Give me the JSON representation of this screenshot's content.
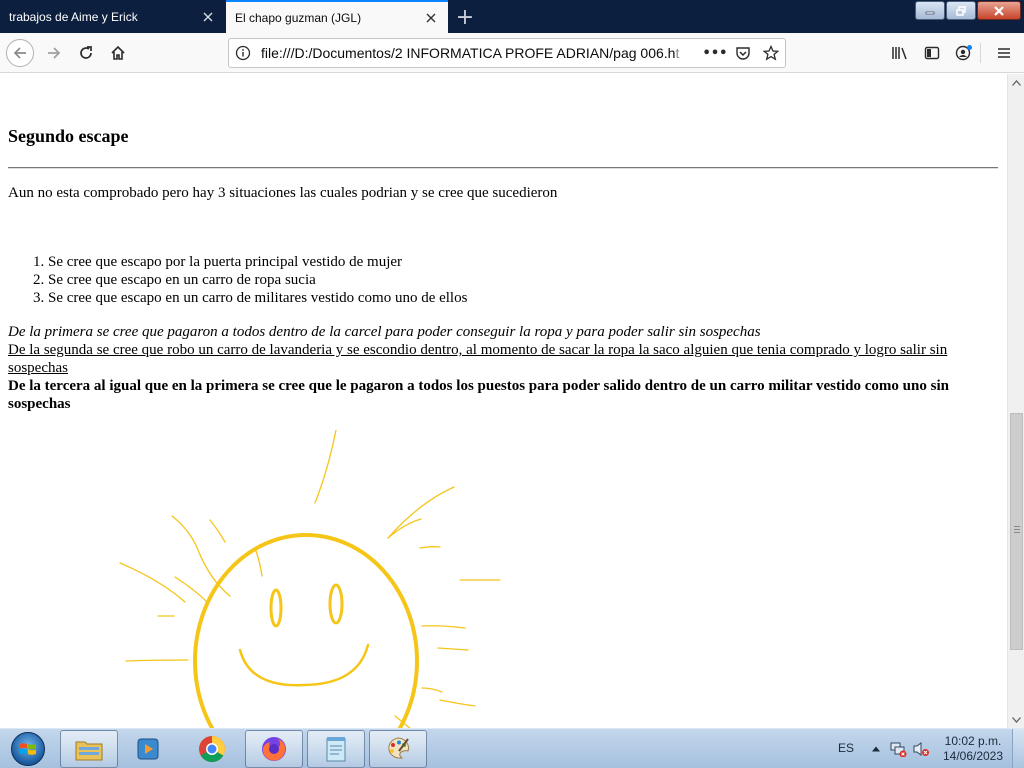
{
  "browser": {
    "tabs": [
      {
        "label": "trabajos de Aime y Erick",
        "active": false
      },
      {
        "label": "El chapo guzman (JGL)",
        "active": true
      }
    ],
    "new_tab_symbol": "+",
    "url": {
      "main": "file:///D:/Documentos/2 INFORMATICA PROFE ADRIAN/pag 006.h",
      "faded": "t"
    },
    "page_actions_symbol": "•••",
    "accent_color": "#0a84ff"
  },
  "page": {
    "heading": "Segundo escape",
    "intro": "Aun no esta comprobado pero hay 3 situaciones las cuales podrian y se cree que sucedieron",
    "situations": [
      "Se cree que escapo por la puerta principal vestido de mujer",
      "Se cree que escapo en un carro de ropa sucia",
      "Se cree que escapo en un carro de militares vestido como uno de ellos"
    ],
    "paragraph_italic": "De la primera se cree que pagaron a todos dentro de la carcel para poder conseguir la ropa y para poder salir sin sospechas",
    "paragraph_underline": "De la segunda se cree que robo un carro de lavanderia y se escondio dentro, al momento de sacar la ropa la saco alguien que tenia comprado y logro salir sin sospechas",
    "paragraph_bold": "De la tercera al igual que en la primera se cree que le pagaron a todos los puestos para poder salido dentro de un carro militar vestido como uno sin sospechas",
    "drawing": {
      "subject": "smiling sun",
      "color": "#f5c518"
    }
  },
  "taskbar": {
    "pinned_apps": [
      "file-explorer",
      "media-player",
      "chrome",
      "firefox",
      "notepad",
      "paint"
    ],
    "language": "ES",
    "time": "10:02 p.m.",
    "date": "14/06/2023"
  }
}
